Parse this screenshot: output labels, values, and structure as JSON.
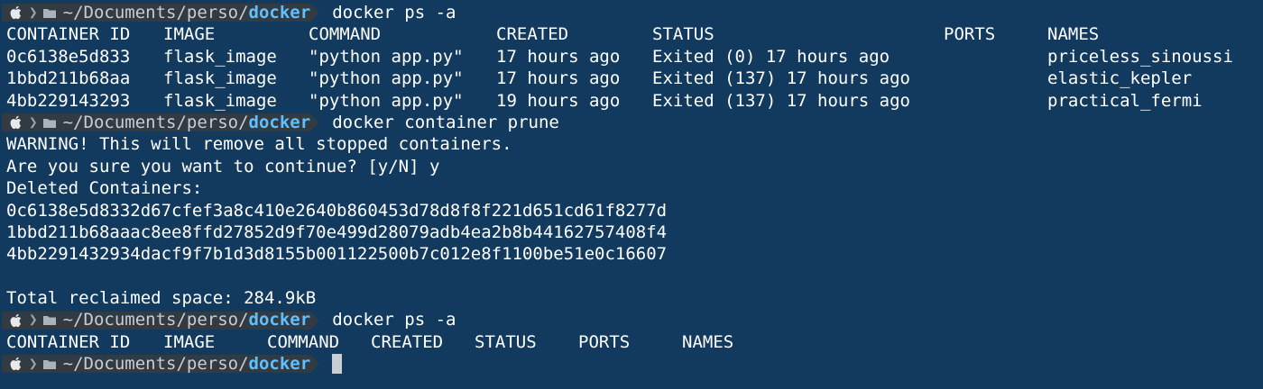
{
  "prompt": {
    "path_prefix": "~/Documents/perso/",
    "cwd": "docker",
    "icon_os": "apple-icon",
    "icon_folder": "folder-icon"
  },
  "commands": [
    "docker ps -a",
    "docker container prune",
    "docker ps -a"
  ],
  "ps1": {
    "headers": [
      "CONTAINER ID",
      "IMAGE",
      "COMMAND",
      "CREATED",
      "STATUS",
      "PORTS",
      "NAMES"
    ],
    "rows": [
      [
        "0c6138e5d833",
        "flask_image",
        "\"python app.py\"",
        "17 hours ago",
        "Exited (0) 17 hours ago",
        "",
        "priceless_sinoussi"
      ],
      [
        "1bbd211b68aa",
        "flask_image",
        "\"python app.py\"",
        "17 hours ago",
        "Exited (137) 17 hours ago",
        "",
        "elastic_kepler"
      ],
      [
        "4bb229143293",
        "flask_image",
        "\"python app.py\"",
        "19 hours ago",
        "Exited (137) 17 hours ago",
        "",
        "practical_fermi"
      ]
    ]
  },
  "prune": {
    "warning": "WARNING! This will remove all stopped containers.",
    "confirm": "Are you sure you want to continue? [y/N] y",
    "deleted_header": "Deleted Containers:",
    "deleted": [
      "0c6138e5d8332d67cfef3a8c410e2640b860453d78d8f8f221d651cd61f8277d",
      "1bbd211b68aaac8ee8ffd27852d9f70e499d28079adb4ea2b8b44162757408f4",
      "4bb2291432934dacf9f7b1d3d8155b001122500b7c012e8f1100be51e0c16607"
    ],
    "total": "Total reclaimed space: 284.9kB"
  },
  "ps2": {
    "headers": [
      "CONTAINER ID",
      "IMAGE",
      "COMMAND",
      "CREATED",
      "STATUS",
      "PORTS",
      "NAMES"
    ]
  },
  "colors": {
    "background": "#123a5e",
    "prompt_bg": "#323a42",
    "cwd": "#5ec0ff"
  }
}
